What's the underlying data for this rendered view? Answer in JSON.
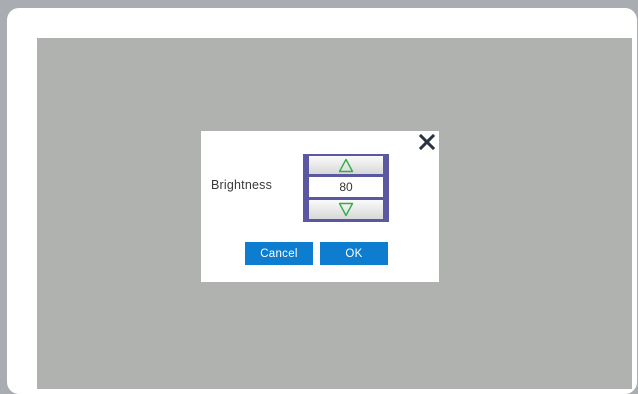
{
  "dialog": {
    "label": "Brightness",
    "value": "80",
    "cancel_label": "Cancel",
    "ok_label": "OK"
  },
  "icons": {
    "close": "close-icon",
    "increase": "up-arrow-icon",
    "decrease": "down-arrow-icon"
  },
  "colors": {
    "primary_button": "#0e7ccf",
    "stepper_frame": "#5b57a0",
    "arrow": "#2fae4a",
    "close": "#2b3442",
    "overlay": "#b0b2af"
  }
}
